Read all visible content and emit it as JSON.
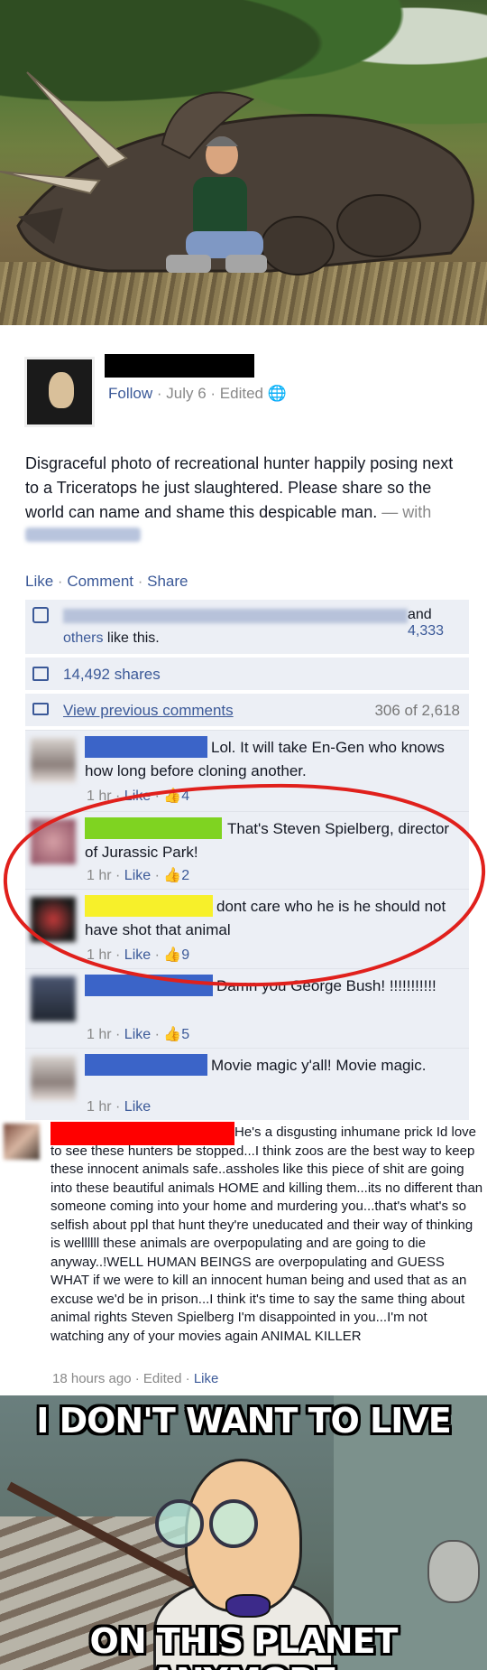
{
  "post": {
    "follow": "Follow",
    "date": "July 6",
    "edited": "Edited",
    "text": "Disgraceful photo of recreational hunter happily posing next to a Triceratops he just slaughtered. Please share so the world can name and shame this despicable man.",
    "with_label": "— with",
    "actions": {
      "like": "Like",
      "comment": "Comment",
      "share": "Share"
    },
    "likes": {
      "and": "and",
      "count": "4,333",
      "others": "others",
      "suffix": "like this."
    },
    "shares": "14,492 shares",
    "view_previous": "View previous comments",
    "comment_count": "306 of 2,618"
  },
  "comments": [
    {
      "text": "Lol. It will take En-Gen who knows how long before cloning another.",
      "time": "1 hr",
      "like": "Like",
      "likes": "4",
      "bar_color": "#3b64c8"
    },
    {
      "text": "That's Steven Spielberg, director of Jurassic Park!",
      "time": "1 hr",
      "like": "Like",
      "likes": "2",
      "bar_color": "#7fd321"
    },
    {
      "text": "dont care who he is he should not have shot that animal",
      "time": "1 hr",
      "like": "Like",
      "likes": "9",
      "bar_color": "#f7f02a"
    },
    {
      "text": "Damn you George Bush! !!!!!!!!!!!",
      "time": "1 hr",
      "like": "Like",
      "likes": "5",
      "bar_color": "#3b64c8"
    },
    {
      "text": "Movie magic y'all! Movie magic.",
      "time": "1 hr",
      "like": "Like",
      "bar_color": "#3b64c8"
    }
  ],
  "second_comment": {
    "text": "He's a disgusting inhumane prick Id love to see these hunters be stopped...I think zoos are the best way to keep these innocent animals safe..assholes like this piece of shit are going into these beautiful animals HOME and killing them...its no different than someone coming into your home and murdering you...that's what's so selfish about ppl that hunt they're uneducated and their way of thinking is wellllll these animals are overpopulating and are going to die anyway..!WELL HUMAN BEINGS are overpopulating and GUESS WHAT if we were to kill an innocent human being and used that as an excuse we'd be in prison...I think it's time to say the same thing about animal rights Steven Spielberg I'm disappointed in you...I'm not watching any of your movies again ANIMAL KILLER",
    "time": "18 hours ago",
    "edited": "Edited",
    "like": "Like",
    "bar_color": "#ff0000"
  },
  "meme": {
    "top_caption": "I DON'T WANT TO LIVE",
    "bottom_caption": "ON THIS PLANET ANYMORE"
  },
  "colors": {
    "fb_blue": "#3b5998",
    "ufi_bg": "#eceff5",
    "circle": "#e0201c"
  }
}
